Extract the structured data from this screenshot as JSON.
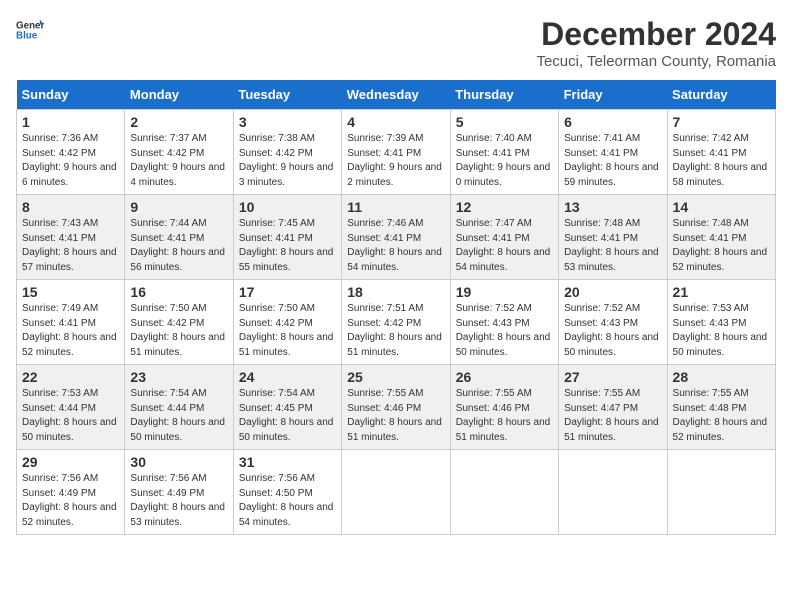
{
  "header": {
    "logo_general": "General",
    "logo_blue": "Blue",
    "title": "December 2024",
    "subtitle": "Tecuci, Teleorman County, Romania"
  },
  "days_of_week": [
    "Sunday",
    "Monday",
    "Tuesday",
    "Wednesday",
    "Thursday",
    "Friday",
    "Saturday"
  ],
  "weeks": [
    [
      {
        "day": "1",
        "sunrise": "7:36 AM",
        "sunset": "4:42 PM",
        "daylight": "9 hours and 6 minutes."
      },
      {
        "day": "2",
        "sunrise": "7:37 AM",
        "sunset": "4:42 PM",
        "daylight": "9 hours and 4 minutes."
      },
      {
        "day": "3",
        "sunrise": "7:38 AM",
        "sunset": "4:42 PM",
        "daylight": "9 hours and 3 minutes."
      },
      {
        "day": "4",
        "sunrise": "7:39 AM",
        "sunset": "4:41 PM",
        "daylight": "9 hours and 2 minutes."
      },
      {
        "day": "5",
        "sunrise": "7:40 AM",
        "sunset": "4:41 PM",
        "daylight": "9 hours and 0 minutes."
      },
      {
        "day": "6",
        "sunrise": "7:41 AM",
        "sunset": "4:41 PM",
        "daylight": "8 hours and 59 minutes."
      },
      {
        "day": "7",
        "sunrise": "7:42 AM",
        "sunset": "4:41 PM",
        "daylight": "8 hours and 58 minutes."
      }
    ],
    [
      {
        "day": "8",
        "sunrise": "7:43 AM",
        "sunset": "4:41 PM",
        "daylight": "8 hours and 57 minutes."
      },
      {
        "day": "9",
        "sunrise": "7:44 AM",
        "sunset": "4:41 PM",
        "daylight": "8 hours and 56 minutes."
      },
      {
        "day": "10",
        "sunrise": "7:45 AM",
        "sunset": "4:41 PM",
        "daylight": "8 hours and 55 minutes."
      },
      {
        "day": "11",
        "sunrise": "7:46 AM",
        "sunset": "4:41 PM",
        "daylight": "8 hours and 54 minutes."
      },
      {
        "day": "12",
        "sunrise": "7:47 AM",
        "sunset": "4:41 PM",
        "daylight": "8 hours and 54 minutes."
      },
      {
        "day": "13",
        "sunrise": "7:48 AM",
        "sunset": "4:41 PM",
        "daylight": "8 hours and 53 minutes."
      },
      {
        "day": "14",
        "sunrise": "7:48 AM",
        "sunset": "4:41 PM",
        "daylight": "8 hours and 52 minutes."
      }
    ],
    [
      {
        "day": "15",
        "sunrise": "7:49 AM",
        "sunset": "4:41 PM",
        "daylight": "8 hours and 52 minutes."
      },
      {
        "day": "16",
        "sunrise": "7:50 AM",
        "sunset": "4:42 PM",
        "daylight": "8 hours and 51 minutes."
      },
      {
        "day": "17",
        "sunrise": "7:50 AM",
        "sunset": "4:42 PM",
        "daylight": "8 hours and 51 minutes."
      },
      {
        "day": "18",
        "sunrise": "7:51 AM",
        "sunset": "4:42 PM",
        "daylight": "8 hours and 51 minutes."
      },
      {
        "day": "19",
        "sunrise": "7:52 AM",
        "sunset": "4:43 PM",
        "daylight": "8 hours and 50 minutes."
      },
      {
        "day": "20",
        "sunrise": "7:52 AM",
        "sunset": "4:43 PM",
        "daylight": "8 hours and 50 minutes."
      },
      {
        "day": "21",
        "sunrise": "7:53 AM",
        "sunset": "4:43 PM",
        "daylight": "8 hours and 50 minutes."
      }
    ],
    [
      {
        "day": "22",
        "sunrise": "7:53 AM",
        "sunset": "4:44 PM",
        "daylight": "8 hours and 50 minutes."
      },
      {
        "day": "23",
        "sunrise": "7:54 AM",
        "sunset": "4:44 PM",
        "daylight": "8 hours and 50 minutes."
      },
      {
        "day": "24",
        "sunrise": "7:54 AM",
        "sunset": "4:45 PM",
        "daylight": "8 hours and 50 minutes."
      },
      {
        "day": "25",
        "sunrise": "7:55 AM",
        "sunset": "4:46 PM",
        "daylight": "8 hours and 51 minutes."
      },
      {
        "day": "26",
        "sunrise": "7:55 AM",
        "sunset": "4:46 PM",
        "daylight": "8 hours and 51 minutes."
      },
      {
        "day": "27",
        "sunrise": "7:55 AM",
        "sunset": "4:47 PM",
        "daylight": "8 hours and 51 minutes."
      },
      {
        "day": "28",
        "sunrise": "7:55 AM",
        "sunset": "4:48 PM",
        "daylight": "8 hours and 52 minutes."
      }
    ],
    [
      {
        "day": "29",
        "sunrise": "7:56 AM",
        "sunset": "4:49 PM",
        "daylight": "8 hours and 52 minutes."
      },
      {
        "day": "30",
        "sunrise": "7:56 AM",
        "sunset": "4:49 PM",
        "daylight": "8 hours and 53 minutes."
      },
      {
        "day": "31",
        "sunrise": "7:56 AM",
        "sunset": "4:50 PM",
        "daylight": "8 hours and 54 minutes."
      },
      null,
      null,
      null,
      null
    ]
  ]
}
